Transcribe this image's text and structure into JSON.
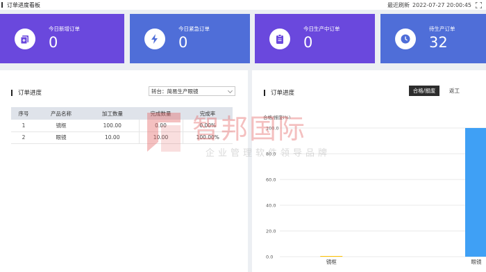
{
  "header": {
    "title": "订单进度看板",
    "refresh_label": "最近刷新",
    "refresh_time": "2022-07-27 20:00:45"
  },
  "cards": [
    {
      "label": "今日新增订单",
      "value": "0",
      "icon": "add-document-icon"
    },
    {
      "label": "今日紧急订单",
      "value": "0",
      "icon": "lightning-icon"
    },
    {
      "label": "今日生产中订单",
      "value": "0",
      "icon": "clipboard-icon"
    },
    {
      "label": "待生产订单",
      "value": "32",
      "icon": "clock-icon"
    }
  ],
  "left_panel": {
    "title": "订单进度",
    "select_value": "转台：简易生产眼镜",
    "columns": [
      "序号",
      "产品名称",
      "加工数量",
      "完成数量",
      "完成率"
    ],
    "rows": [
      [
        "1",
        "镜框",
        "100.00",
        "0.00",
        "0.00%"
      ],
      [
        "2",
        "眼镜",
        "10.00",
        "10.00",
        "100.00%"
      ]
    ]
  },
  "right_panel": {
    "title": "订单进度",
    "btn_active": "合格/报废",
    "btn_return": "返工"
  },
  "watermark": {
    "name": "智邦国际",
    "slogan": "企业管理软件领导品牌"
  },
  "chart_data": {
    "type": "bar",
    "ylabel": "合格/报废(%)",
    "ylim": [
      0,
      100
    ],
    "yticks": [
      "100.0",
      "80.0",
      "60.0",
      "40.0",
      "20.0",
      "0.0"
    ],
    "categories": [
      "镜框",
      "眼镜"
    ],
    "values": [
      0,
      100
    ],
    "colors": {
      "bar": "#3fa0f5",
      "bar_accent": "#ffc000",
      "grid": "#e8e8e8"
    }
  }
}
